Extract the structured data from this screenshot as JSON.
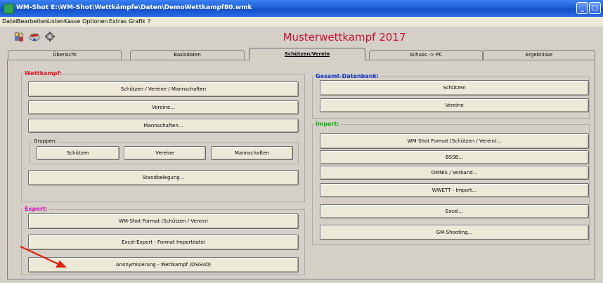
{
  "window": {
    "title": "WM-Shot E:\\WM-Shot\\Wettkämpfe\\Daten\\DemoWettkampf80.wmk"
  },
  "menu": [
    "Datei",
    "Bearbeiten",
    "Listen",
    "Kasse",
    "Optionen",
    "Extras",
    "Grafik",
    "?"
  ],
  "toolbar": {
    "icons": [
      "users-icon",
      "shooter-icon",
      "settings-icon"
    ]
  },
  "app_title": "Musterwettkampf 2017",
  "tabs": [
    "Übersicht",
    "Basisdaten",
    "Schützen/Verein",
    "Schuss -> PC",
    "Ergebnisse"
  ],
  "active_tab": "Schützen/Verein",
  "wettkampf": {
    "label": "Wettkampf:",
    "btn_schuetzen_vereine": "Schützen / Vereine / Mannschaften",
    "btn_vereine": "Vereine...",
    "btn_mannschaften": "Mannschaften...",
    "gruppen": {
      "label": "Gruppen:",
      "btn_schuetzen": "Schützen",
      "btn_vereine": "Vereine",
      "btn_mannschaften": "Mannschaften"
    },
    "btn_standbelegung": "Standbelegung..."
  },
  "export": {
    "label": "Export:",
    "btn_wmshot": "WM-Shot Format (Schützen / Verein)",
    "btn_excel": "Excel-Export - Format Importdatei",
    "btn_anonym": "Anonymisierung - Wettkampf (DSGVO)"
  },
  "gesamt": {
    "label": "Gesamt-Datenbank:",
    "btn_schuetzen": "Schützen",
    "btn_vereine": "Vereine"
  },
  "import": {
    "label": "Import:",
    "btn_wmshot": "WM-Shot Format (Schützen / Verein)...",
    "btn_bssb": "BSSB...",
    "btn_omnis": "OMNIS / Verband...",
    "btn_wwett": "WWETT - Import...",
    "btn_excel": "Excel...",
    "btn_gm": "GM-Shooting..."
  },
  "colors": {
    "wettkampf_label": "#e8101e",
    "export_label": "#e010c0",
    "gesamt_label": "#1030c8",
    "import_label": "#10b010",
    "app_title": "#c8102e",
    "arrow": "#e02010"
  }
}
